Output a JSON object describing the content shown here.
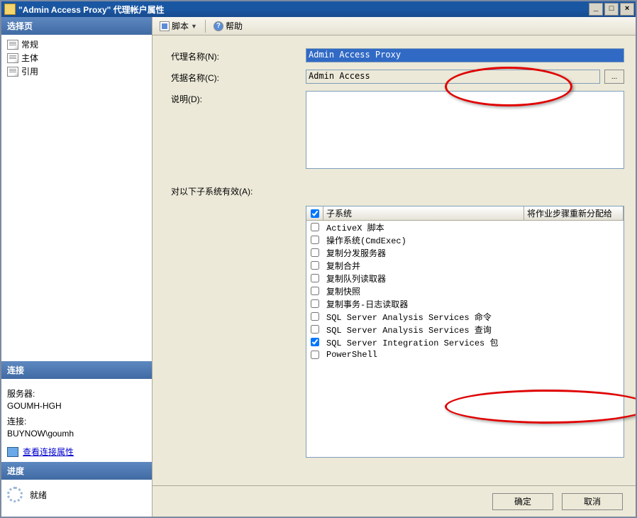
{
  "window": {
    "title": "\"Admin Access Proxy\" 代理帐户属性"
  },
  "titlebar_buttons": {
    "min": "_",
    "max": "□",
    "close": "×"
  },
  "leftpane": {
    "select_header": "选择页",
    "nav": [
      "常规",
      "主体",
      "引用"
    ],
    "connection_header": "连接",
    "server_label": "服务器:",
    "server_value": "GOUMH-HGH",
    "conn_label": "连接:",
    "conn_value": "BUYNOW\\goumh",
    "view_link": "查看连接属性",
    "progress_header": "进度",
    "progress_status": "就绪"
  },
  "toolbar": {
    "script": "脚本",
    "help": "帮助"
  },
  "form": {
    "proxy_name_label": "代理名称(N):",
    "proxy_name_value": "Admin Access Proxy",
    "cred_name_label": "凭据名称(C):",
    "cred_name_value": "Admin Access",
    "browse_btn": "...",
    "desc_label": "说明(D):",
    "desc_value": "",
    "active_label": "对以下子系统有效(A):"
  },
  "grid": {
    "col1": "子系统",
    "col2": "将作业步骤重新分配给",
    "rows": [
      {
        "checked": false,
        "label": "ActiveX 脚本"
      },
      {
        "checked": false,
        "label": "操作系统(CmdExec)"
      },
      {
        "checked": false,
        "label": "复制分发服务器"
      },
      {
        "checked": false,
        "label": "复制合并"
      },
      {
        "checked": false,
        "label": "复制队列读取器"
      },
      {
        "checked": false,
        "label": "复制快照"
      },
      {
        "checked": false,
        "label": "复制事务-日志读取器"
      },
      {
        "checked": false,
        "label": "SQL Server Analysis Services 命令"
      },
      {
        "checked": false,
        "label": "SQL Server Analysis Services 查询"
      },
      {
        "checked": true,
        "label": "SQL Server Integration Services 包"
      },
      {
        "checked": false,
        "label": "PowerShell"
      }
    ]
  },
  "footer": {
    "ok": "确定",
    "cancel": "取消"
  }
}
